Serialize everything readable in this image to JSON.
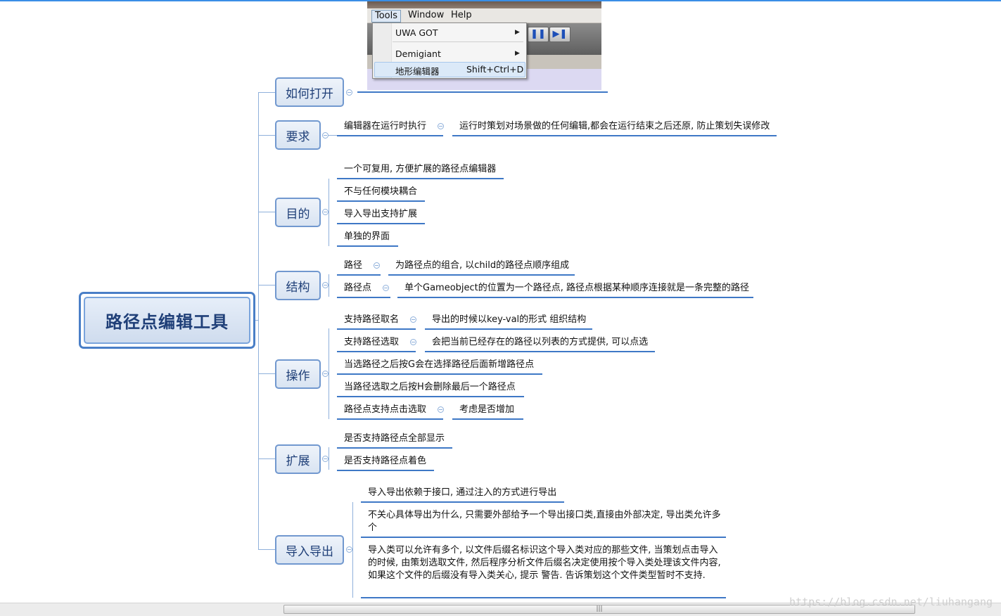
{
  "menu_screenshot": {
    "menubar": [
      "Tools",
      "Window",
      "Help"
    ],
    "items": [
      {
        "label": "UWA GOT",
        "submenu": true
      },
      {
        "label": "Demigiant",
        "submenu": true
      },
      {
        "label": "地形编辑器",
        "shortcut": "Shift+Ctrl+D",
        "highlighted": true
      }
    ]
  },
  "root": {
    "label": "路径点编辑工具"
  },
  "branches": [
    {
      "label": "如何打开",
      "children": []
    },
    {
      "label": "要求",
      "children": [
        {
          "label": "编辑器在运行时执行",
          "sub": [
            "运行时策划对场景做的任何编辑,都会在运行结束之后还原, 防止策划失误修改"
          ]
        }
      ]
    },
    {
      "label": "目的",
      "children": [
        {
          "label": "一个可复用, 方便扩展的路径点编辑器"
        },
        {
          "label": "不与任何模块耦合"
        },
        {
          "label": "导入导出支持扩展"
        },
        {
          "label": "单独的界面"
        }
      ]
    },
    {
      "label": "结构",
      "children": [
        {
          "label": "路径",
          "sub": [
            "为路径点的组合, 以child的路径点顺序组成"
          ]
        },
        {
          "label": "路径点",
          "sub": [
            "单个Gameobject的位置为一个路径点, 路径点根据某种顺序连接就是一条完整的路径"
          ]
        }
      ]
    },
    {
      "label": "操作",
      "children": [
        {
          "label": "支持路径取名",
          "sub": [
            "导出的时候以key-val的形式 组织结构"
          ]
        },
        {
          "label": "支持路径选取",
          "sub": [
            "会把当前已经存在的路径以列表的方式提供, 可以点选"
          ]
        },
        {
          "label": "当选路径之后按G会在选择路径后面新增路径点"
        },
        {
          "label": "当路径选取之后按H会删除最后一个路径点"
        },
        {
          "label": "路径点支持点击选取",
          "sub": [
            "考虑是否增加"
          ]
        }
      ]
    },
    {
      "label": "扩展",
      "children": [
        {
          "label": "是否支持路径点全部显示"
        },
        {
          "label": "是否支持路径点着色"
        }
      ]
    },
    {
      "label": "导入导出",
      "children": [
        {
          "label": "导入导出依赖于接口, 通过注入的方式进行导出"
        },
        {
          "label": "不关心具体导出为什么, 只需要外部给予一个导出接口类,直接由外部决定, 导出类允许多个"
        },
        {
          "label": "导入类可以允许有多个, 以文件后缀名标识这个导入类对应的那些文件, 当策划点击导入的时候, 由策划选取文件,   然后程序分析文件后缀名决定使用按个导入类处理该文件内容, 如果这个文件的后缀没有导入类关心,  提示 警告. 告诉策划这个文件类型暂时不支持."
        }
      ]
    }
  ],
  "watermark": "https://blog.csdn.net/liuhangang",
  "colors": {
    "accent": "#3e78c6",
    "node_border": "#7198cf",
    "connector": "#8fb0db",
    "root_text": "#1f3f78"
  }
}
